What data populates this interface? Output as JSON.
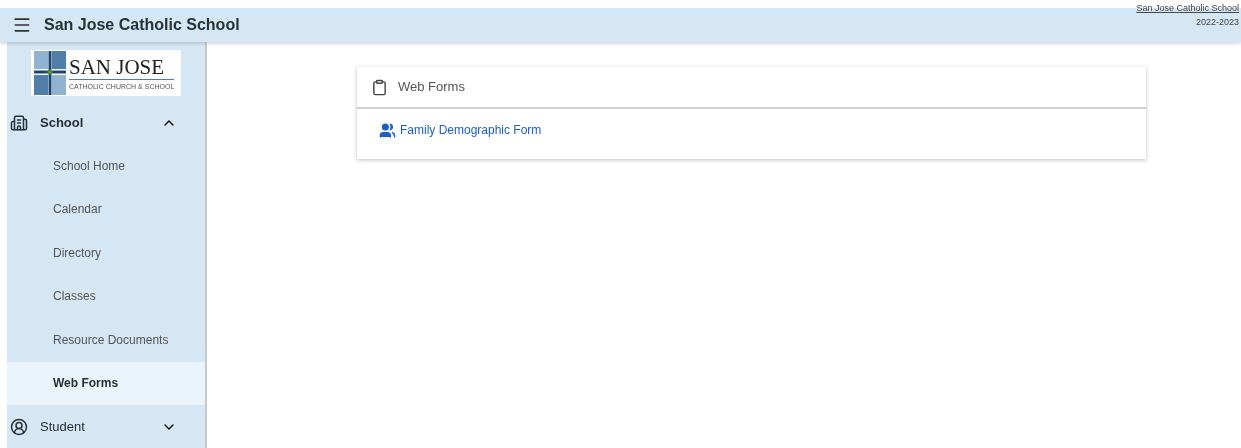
{
  "header": {
    "title": "San Jose Catholic School",
    "school_link": "San Jose Catholic School",
    "year": "2022-2023"
  },
  "logo": {
    "name": "SAN JOSE",
    "subtitle": "CATHOLIC CHURCH & SCHOOL"
  },
  "sidebar": {
    "sections": [
      {
        "kind": "building",
        "label": "School",
        "expanded": true,
        "items": [
          {
            "label": "School Home",
            "selected": false
          },
          {
            "label": "Calendar",
            "selected": false
          },
          {
            "label": "Directory",
            "selected": false
          },
          {
            "label": "Classes",
            "selected": false
          },
          {
            "label": "Resource Documents",
            "selected": false
          },
          {
            "label": "Web Forms",
            "selected": true
          }
        ]
      },
      {
        "kind": "person",
        "label": "Student",
        "expanded": false
      }
    ]
  },
  "card": {
    "title": "Web Forms",
    "links": [
      "Family Demographic Form"
    ]
  }
}
